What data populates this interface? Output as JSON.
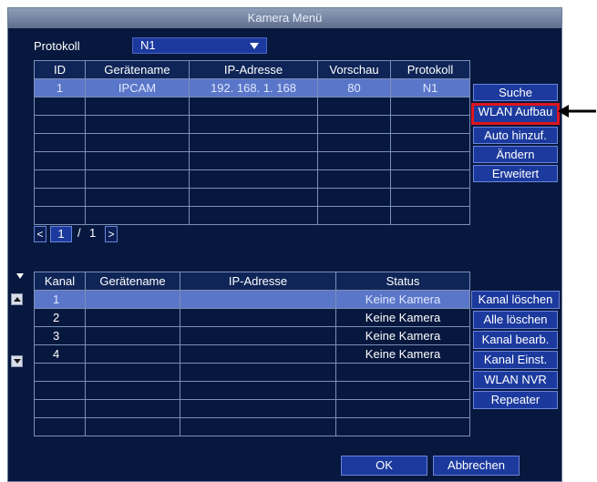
{
  "window": {
    "title": "Kamera Menü"
  },
  "protocol": {
    "label": "Protokoll",
    "value": "N1"
  },
  "device_table": {
    "columns": [
      "ID",
      "Gerätename",
      "IP-Adresse",
      "Vorschau",
      "Protokoll"
    ],
    "rows": [
      [
        "1",
        "IPCAM",
        "192. 168. 1. 168",
        "80",
        "N1"
      ],
      [
        "",
        "",
        "",
        "",
        ""
      ],
      [
        "",
        "",
        "",
        "",
        ""
      ],
      [
        "",
        "",
        "",
        "",
        ""
      ],
      [
        "",
        "",
        "",
        "",
        ""
      ],
      [
        "",
        "",
        "",
        "",
        ""
      ],
      [
        "",
        "",
        "",
        "",
        ""
      ],
      [
        "",
        "",
        "",
        "",
        ""
      ]
    ]
  },
  "device_buttons": [
    "Suche",
    "WLAN Aufbau",
    "Auto hinzuf.",
    "Ändern",
    "Erweitert"
  ],
  "pager": {
    "current": "1",
    "separator": "/",
    "total": "1",
    "prev": "<",
    "next": ">"
  },
  "channel_table": {
    "columns": [
      "Kanal",
      "Gerätename",
      "IP-Adresse",
      "Status"
    ],
    "rows": [
      [
        "1",
        "",
        "",
        "Keine Kamera"
      ],
      [
        "2",
        "",
        "",
        "Keine Kamera"
      ],
      [
        "3",
        "",
        "",
        "Keine Kamera"
      ],
      [
        "4",
        "",
        "",
        "Keine Kamera"
      ],
      [
        "",
        "",
        "",
        ""
      ],
      [
        "",
        "",
        "",
        ""
      ],
      [
        "",
        "",
        "",
        ""
      ],
      [
        "",
        "",
        "",
        ""
      ]
    ]
  },
  "channel_buttons": [
    "Kanal löschen",
    "Alle löschen",
    "Kanal bearb.",
    "Kanal Einst.",
    "WLAN NVR",
    "Repeater"
  ],
  "footer": {
    "ok": "OK",
    "cancel": "Abbrechen"
  },
  "colors": {
    "background": "#07183f",
    "button": "#1c3a9e",
    "selected_row": "#5a76c8",
    "highlight": "#e0141c"
  }
}
